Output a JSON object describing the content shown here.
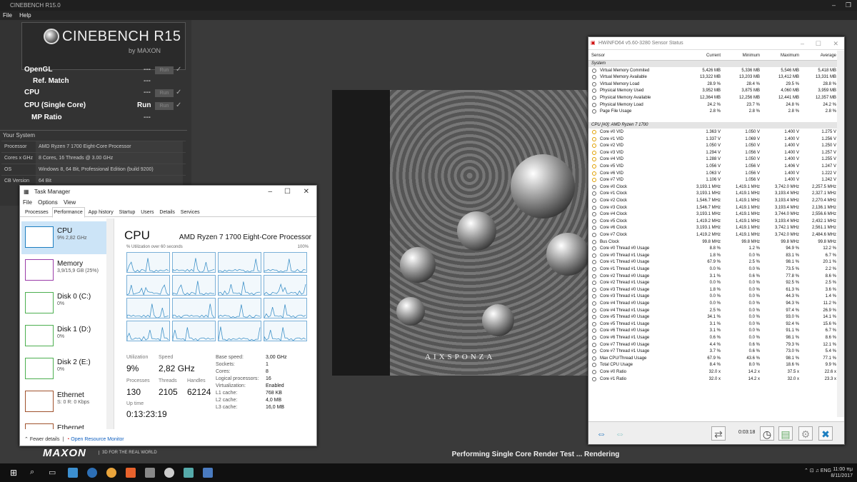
{
  "cinebench": {
    "window_title": "CINEBENCH R15.0",
    "menu": [
      "File",
      "Help"
    ],
    "logo_title": "CINEBENCH R15",
    "logo_sub": "by MAXON",
    "rows": [
      {
        "label": "OpenGL",
        "value": "---",
        "run": "Run",
        "indent": false
      },
      {
        "label": "Ref. Match",
        "value": "---",
        "run": "",
        "indent": true
      },
      {
        "label": "CPU",
        "value": "---",
        "run": "Run",
        "indent": false
      },
      {
        "label": "CPU (Single Core)",
        "value": "Run",
        "run": "Run",
        "indent": false
      },
      {
        "label": "MP Ratio",
        "value": "---",
        "run": "",
        "indent": true
      }
    ],
    "your_system": "Your System",
    "system": [
      {
        "k": "Processor",
        "v": "AMD Ryzen 7 1700 Eight-Core Processor"
      },
      {
        "k": "Cores x GHz",
        "v": "8 Cores, 16 Threads @ 3.00 GHz"
      },
      {
        "k": "OS",
        "v": "Windows 8, 64 Bit, Professional Edition (build 9200)"
      },
      {
        "k": "CB Version",
        "v": "64 Bit"
      }
    ],
    "status": "Performing Single Core Render Test ... Rendering",
    "maxon": "MAXON",
    "maxon_tag": "3D FOR THE REAL WORLD",
    "render_brand": "AIXSPONZA"
  },
  "taskmanager": {
    "title": "Task Manager",
    "menu": [
      "File",
      "Options",
      "View"
    ],
    "tabs": [
      "Processes",
      "Performance",
      "App history",
      "Startup",
      "Users",
      "Details",
      "Services"
    ],
    "side": [
      {
        "name": "CPU",
        "sub": "9% 2,82 GHz",
        "color": "#1c7ec0"
      },
      {
        "name": "Memory",
        "sub": "3,9/15,9 GB (25%)",
        "color": "#9b3ca8"
      },
      {
        "name": "Disk 0 (C:)",
        "sub": "0%",
        "color": "#4caf50"
      },
      {
        "name": "Disk 1 (D:)",
        "sub": "0%",
        "color": "#4caf50"
      },
      {
        "name": "Disk 2 (E:)",
        "sub": "0%",
        "color": "#4caf50"
      },
      {
        "name": "Ethernet",
        "sub": "S: 0 R: 0 Kbps",
        "color": "#a0522d"
      },
      {
        "name": "Ethernet",
        "sub": "S: 0 R: 0 Kbps",
        "color": "#a0522d"
      },
      {
        "name": "GPU 0",
        "sub": "Radeon (TM) RX 470",
        "color": "#1c7ec0"
      }
    ],
    "cpu_title": "CPU",
    "cpu_model": "AMD Ryzen 7 1700 Eight-Core Processor",
    "util_label": "% Utilization over 60 seconds",
    "util_max": "100%",
    "stats": {
      "utilization_label": "Utilization",
      "utilization": "9%",
      "speed_label": "Speed",
      "speed": "2,82 GHz",
      "processes_label": "Processes",
      "processes": "130",
      "threads_label": "Threads",
      "threads": "2105",
      "handles_label": "Handles",
      "handles": "62124",
      "uptime_label": "Up time",
      "uptime": "0:13:23:19"
    },
    "specs": [
      {
        "k": "Base speed:",
        "v": "3,00 GHz"
      },
      {
        "k": "Sockets:",
        "v": "1"
      },
      {
        "k": "Cores:",
        "v": "8"
      },
      {
        "k": "Logical processors:",
        "v": "16"
      },
      {
        "k": "Virtualization:",
        "v": "Enabled"
      },
      {
        "k": "L1 cache:",
        "v": "768 KB"
      },
      {
        "k": "L2 cache:",
        "v": "4,0 MB"
      },
      {
        "k": "L3 cache:",
        "v": "16,0 MB"
      }
    ],
    "fewer_details": "Fewer details",
    "resource_monitor": "Open Resource Monitor"
  },
  "hwinfo": {
    "title": "HWiNFO64 v5.60-3280 Sensor Status",
    "columns": [
      "Sensor",
      "Current",
      "Minimum",
      "Maximum",
      "Average"
    ],
    "rows": [
      {
        "g": "System"
      },
      {
        "n": "Virtual Memory Commited",
        "c": "5,426 MB",
        "mn": "5,336 MB",
        "mx": "5,546 MB",
        "av": "5,418 MB"
      },
      {
        "n": "Virtual Memory Available",
        "c": "13,322 MB",
        "mn": "13,203 MB",
        "mx": "13,412 MB",
        "av": "13,331 MB"
      },
      {
        "n": "Virtual Memory Load",
        "c": "28.9 %",
        "mn": "28.4 %",
        "mx": "29.5 %",
        "av": "28.8 %"
      },
      {
        "n": "Physical Memory Used",
        "c": "3,952 MB",
        "mn": "3,875 MB",
        "mx": "4,060 MB",
        "av": "3,959 MB"
      },
      {
        "n": "Physical Memory Available",
        "c": "12,364 MB",
        "mn": "12,256 MB",
        "mx": "12,441 MB",
        "av": "12,357 MB"
      },
      {
        "n": "Physical Memory Load",
        "c": "24.2 %",
        "mn": "23.7 %",
        "mx": "24.8 %",
        "av": "24.2 %"
      },
      {
        "n": "Page File Usage",
        "c": "2.8 %",
        "mn": "2.8 %",
        "mx": "2.8 %",
        "av": "2.8 %"
      },
      {
        "blank": true
      },
      {
        "g": "CPU [#0]: AMD Ryzen 7 1700"
      },
      {
        "n": "Core #0 VID",
        "c": "1.363 V",
        "mn": "1.050 V",
        "mx": "1.400 V",
        "av": "1.275 V"
      },
      {
        "n": "Core #1 VID",
        "c": "1.337 V",
        "mn": "1.069 V",
        "mx": "1.400 V",
        "av": "1.256 V"
      },
      {
        "n": "Core #2 VID",
        "c": "1.050 V",
        "mn": "1.050 V",
        "mx": "1.400 V",
        "av": "1.250 V"
      },
      {
        "n": "Core #3 VID",
        "c": "1.294 V",
        "mn": "1.056 V",
        "mx": "1.400 V",
        "av": "1.257 V"
      },
      {
        "n": "Core #4 VID",
        "c": "1.288 V",
        "mn": "1.050 V",
        "mx": "1.400 V",
        "av": "1.255 V"
      },
      {
        "n": "Core #5 VID",
        "c": "1.056 V",
        "mn": "1.056 V",
        "mx": "1.406 V",
        "av": "1.247 V"
      },
      {
        "n": "Core #6 VID",
        "c": "1.063 V",
        "mn": "1.056 V",
        "mx": "1.400 V",
        "av": "1.222 V"
      },
      {
        "n": "Core #7 VID",
        "c": "1.106 V",
        "mn": "1.056 V",
        "mx": "1.400 V",
        "av": "1.242 V"
      },
      {
        "n": "Core #0 Clock",
        "c": "3,193.1 MHz",
        "mn": "1,419.1 MHz",
        "mx": "3,742.0 MHz",
        "av": "2,257.5 MHz"
      },
      {
        "n": "Core #1 Clock",
        "c": "3,193.1 MHz",
        "mn": "1,419.1 MHz",
        "mx": "3,193.4 MHz",
        "av": "2,327.1 MHz"
      },
      {
        "n": "Core #2 Clock",
        "c": "1,546.7 MHz",
        "mn": "1,419.1 MHz",
        "mx": "3,193.4 MHz",
        "av": "2,270.4 MHz"
      },
      {
        "n": "Core #3 Clock",
        "c": "1,546.7 MHz",
        "mn": "1,419.1 MHz",
        "mx": "3,193.4 MHz",
        "av": "2,136.1 MHz"
      },
      {
        "n": "Core #4 Clock",
        "c": "3,193.1 MHz",
        "mn": "1,419.1 MHz",
        "mx": "3,744.0 MHz",
        "av": "2,556.6 MHz"
      },
      {
        "n": "Core #5 Clock",
        "c": "1,419.2 MHz",
        "mn": "1,419.1 MHz",
        "mx": "3,193.4 MHz",
        "av": "2,432.1 MHz"
      },
      {
        "n": "Core #6 Clock",
        "c": "3,193.1 MHz",
        "mn": "1,419.1 MHz",
        "mx": "3,742.1 MHz",
        "av": "2,561.1 MHz"
      },
      {
        "n": "Core #7 Clock",
        "c": "1,419.2 MHz",
        "mn": "1,419.1 MHz",
        "mx": "3,742.0 MHz",
        "av": "2,484.6 MHz"
      },
      {
        "n": "Bus Clock",
        "c": "99.8 MHz",
        "mn": "99.8 MHz",
        "mx": "99.8 MHz",
        "av": "99.8 MHz"
      },
      {
        "n": "Core #0 Thread #0 Usage",
        "c": "8.8 %",
        "mn": "1.2 %",
        "mx": "94.9 %",
        "av": "12.2 %"
      },
      {
        "n": "Core #0 Thread #1 Usage",
        "c": "1.8 %",
        "mn": "0.0 %",
        "mx": "83.1 %",
        "av": "6.7 %"
      },
      {
        "n": "Core #1 Thread #0 Usage",
        "c": "67.9 %",
        "mn": "2.5 %",
        "mx": "98.1 %",
        "av": "20.1 %"
      },
      {
        "n": "Core #1 Thread #1 Usage",
        "c": "0.0 %",
        "mn": "0.0 %",
        "mx": "73.5 %",
        "av": "2.2 %"
      },
      {
        "n": "Core #2 Thread #0 Usage",
        "c": "3.1 %",
        "mn": "0.6 %",
        "mx": "77.8 %",
        "av": "8.6 %"
      },
      {
        "n": "Core #2 Thread #1 Usage",
        "c": "0.0 %",
        "mn": "0.0 %",
        "mx": "92.5 %",
        "av": "2.5 %"
      },
      {
        "n": "Core #3 Thread #0 Usage",
        "c": "1.8 %",
        "mn": "0.0 %",
        "mx": "61.3 %",
        "av": "3.6 %"
      },
      {
        "n": "Core #3 Thread #1 Usage",
        "c": "0.0 %",
        "mn": "0.0 %",
        "mx": "44.3 %",
        "av": "1.4 %"
      },
      {
        "n": "Core #4 Thread #0 Usage",
        "c": "0.0 %",
        "mn": "0.0 %",
        "mx": "94.3 %",
        "av": "11.2 %"
      },
      {
        "n": "Core #4 Thread #1 Usage",
        "c": "2.5 %",
        "mn": "0.0 %",
        "mx": "97.4 %",
        "av": "26.9 %"
      },
      {
        "n": "Core #5 Thread #0 Usage",
        "c": "34.1 %",
        "mn": "0.0 %",
        "mx": "93.0 %",
        "av": "14.1 %"
      },
      {
        "n": "Core #5 Thread #1 Usage",
        "c": "3.1 %",
        "mn": "0.0 %",
        "mx": "92.4 %",
        "av": "15.6 %"
      },
      {
        "n": "Core #6 Thread #0 Usage",
        "c": "3.1 %",
        "mn": "0.0 %",
        "mx": "91.1 %",
        "av": "6.7 %"
      },
      {
        "n": "Core #6 Thread #1 Usage",
        "c": "0.6 %",
        "mn": "0.0 %",
        "mx": "98.1 %",
        "av": "8.6 %"
      },
      {
        "n": "Core #7 Thread #0 Usage",
        "c": "4.4 %",
        "mn": "0.6 %",
        "mx": "79.3 %",
        "av": "12.1 %"
      },
      {
        "n": "Core #7 Thread #1 Usage",
        "c": "3.7 %",
        "mn": "0.6 %",
        "mx": "73.0 %",
        "av": "5.4 %"
      },
      {
        "n": "Max CPU/Thread Usage",
        "c": "67.9 %",
        "mn": "43.6 %",
        "mx": "98.1 %",
        "av": "77.1 %"
      },
      {
        "n": "Total CPU Usage",
        "c": "8.4 %",
        "mn": "8.0 %",
        "mx": "18.6 %",
        "av": "9.9 %"
      },
      {
        "n": "Core #0 Ratio",
        "c": "32.0 x",
        "mn": "14.2 x",
        "mx": "37.5 x",
        "av": "22.6 x"
      },
      {
        "n": "Core #1 Ratio",
        "c": "32.0 x",
        "mn": "14.2 x",
        "mx": "32.0 x",
        "av": "23.3 x"
      }
    ],
    "timer": "0:03:18"
  },
  "taskbar": {
    "lang": "ENG",
    "time": "11:00 πμ",
    "date": "8/11/2017"
  }
}
